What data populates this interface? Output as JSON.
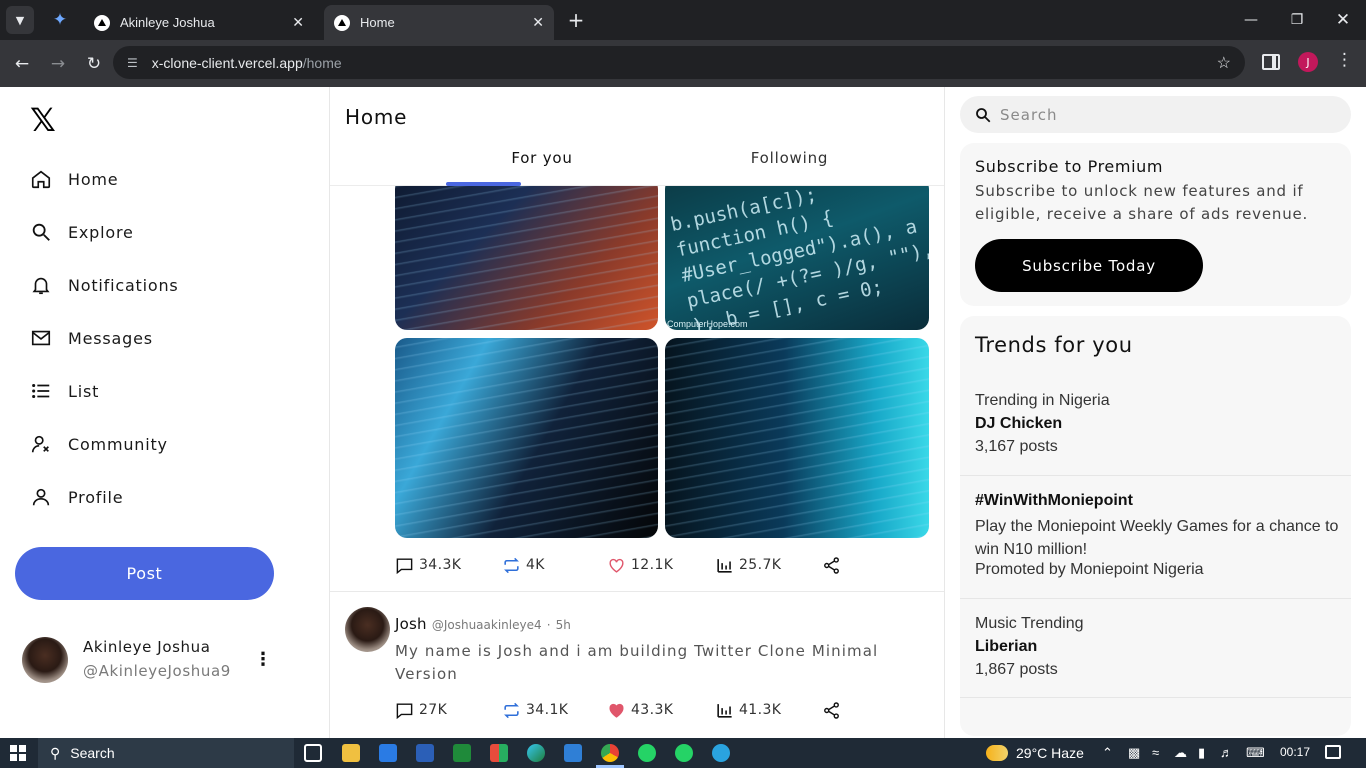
{
  "browser": {
    "tabs": [
      {
        "title": "Akinleye Joshua",
        "active": false
      },
      {
        "title": "Home",
        "active": true
      }
    ],
    "url_host": "x-clone-client.vercel.app",
    "url_path": "/home",
    "profile_initial": "J",
    "accent": "#c2185b"
  },
  "sidebar": {
    "logo": "𝕏",
    "items": [
      {
        "label": "Home",
        "icon": "home-icon"
      },
      {
        "label": "Explore",
        "icon": "search-icon"
      },
      {
        "label": "Notifications",
        "icon": "bell-icon"
      },
      {
        "label": "Messages",
        "icon": "mail-icon"
      },
      {
        "label": "List",
        "icon": "list-icon"
      },
      {
        "label": "Community",
        "icon": "community-icon"
      },
      {
        "label": "Profile",
        "icon": "user-icon"
      }
    ],
    "post_label": "Post",
    "post_color": "#4a67e0",
    "user": {
      "name": "Akinleye Joshua",
      "handle": "@AkinleyeJoshua9"
    }
  },
  "main": {
    "title": "Home",
    "tabs": [
      {
        "label": "For you",
        "active": true
      },
      {
        "label": "Following",
        "active": false
      }
    ],
    "post1": {
      "image_credit": "ComputerHope.com",
      "image_code": [
        "b.push(a[c]);",
        "function h() {",
        "#User_logged\").a(), a",
        "place(/ +(?= )/g, \"\"),",
        "), b = [], c = 0;"
      ],
      "stats": {
        "comments": "34.3K",
        "retweets": "4K",
        "likes": "12.1K",
        "views": "25.7K"
      },
      "liked": false
    },
    "post2": {
      "author": "Josh",
      "username": "@Joshuaakinleye4",
      "dot": "·",
      "time": "5h",
      "text": "My name is Josh and i am building Twitter Clone Minimal Version",
      "stats": {
        "comments": "27K",
        "retweets": "34.1K",
        "likes": "43.3K",
        "views": "41.3K"
      },
      "liked": true
    }
  },
  "right": {
    "search_placeholder": "Search",
    "premium": {
      "title": "Subscribe to Premium",
      "text": "Subscribe to unlock new features and if eligible, receive a share of ads revenue.",
      "button": "Subscribe Today"
    },
    "trends_title": "Trends for you",
    "trends": [
      {
        "context": "Trending in Nigeria",
        "name": "DJ Chicken",
        "extra": "3,167 posts"
      },
      {
        "name": "#WinWithMoniepoint",
        "desc": "Play the Moniepoint Weekly Games for a chance to win N10 million!",
        "extra": "Promoted by Moniepoint Nigeria"
      },
      {
        "context": "Music Trending",
        "name": "Liberian",
        "extra": "1,867 posts"
      }
    ]
  },
  "taskbar": {
    "search": "Search",
    "weather": "29°C  Haze",
    "time": "00:17"
  }
}
